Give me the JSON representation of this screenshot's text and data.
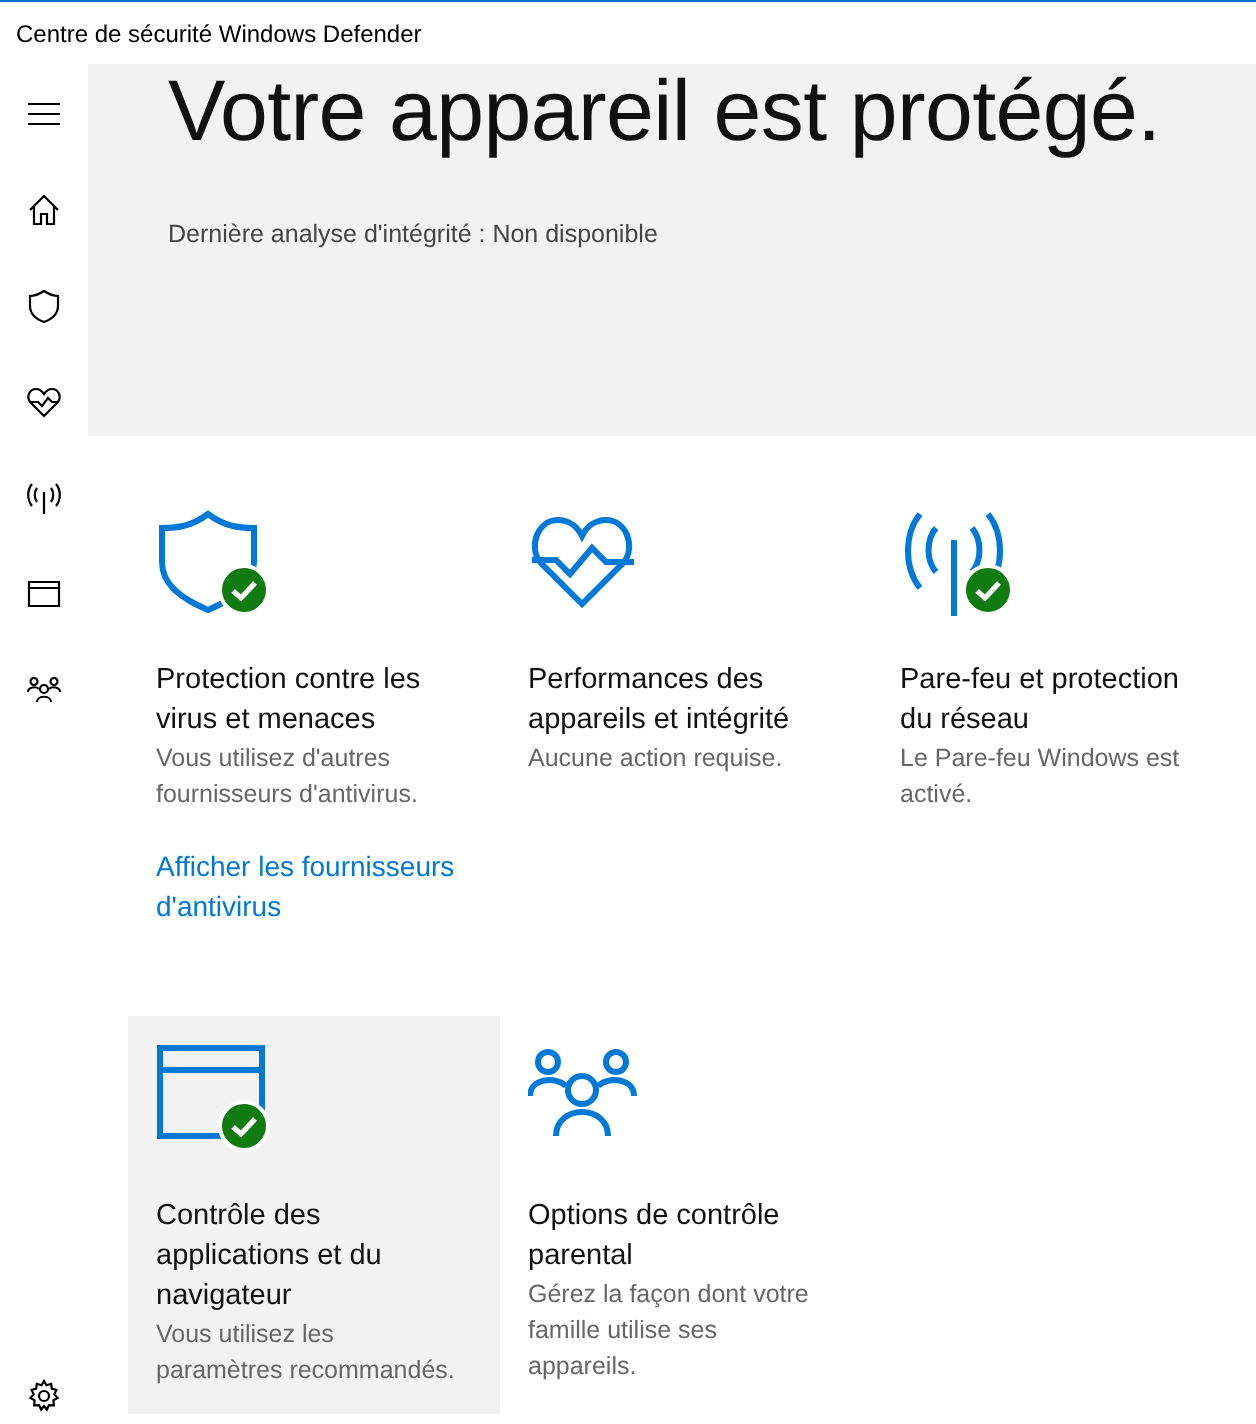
{
  "window": {
    "title": "Centre de sécurité Windows Defender"
  },
  "hero": {
    "heading": "Votre appareil est protégé.",
    "status": "Dernière analyse d'intégrité : Non disponible"
  },
  "tiles": [
    {
      "kind": "shield",
      "title": "Protection contre les virus et menaces",
      "description": "Vous utilisez d'autres fournisseurs d'antivirus.",
      "link": "Afficher les fournisseurs d'antivirus",
      "ok": true,
      "highlighted": false
    },
    {
      "kind": "heart",
      "title": "Performances des appareils et intégrité",
      "description": "Aucune action requise.",
      "ok": false,
      "highlighted": false
    },
    {
      "kind": "antenna",
      "title": "Pare-feu et protection du réseau",
      "description": "Le Pare-feu Windows est activé.",
      "ok": true,
      "highlighted": false
    },
    {
      "kind": "window",
      "title": "Contrôle des applications et du navigateur",
      "description": "Vous utilisez les paramètres recommandés.",
      "ok": true,
      "highlighted": true
    },
    {
      "kind": "family",
      "title": "Options de contrôle parental",
      "description": "Gérez la façon dont votre famille utilise ses appareils.",
      "ok": false,
      "highlighted": false
    }
  ]
}
